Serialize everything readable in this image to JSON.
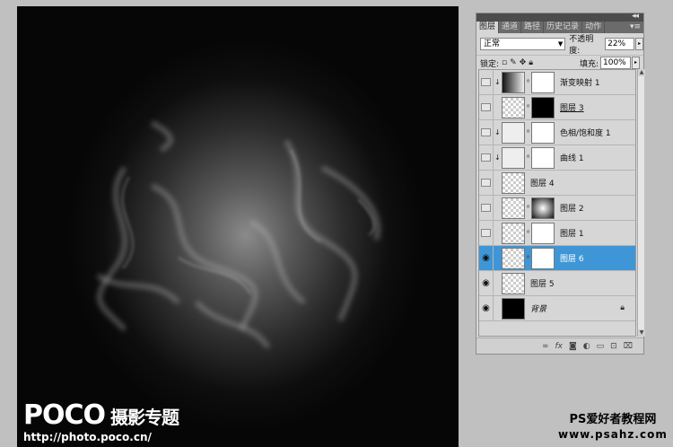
{
  "panel": {
    "collapse_glyph": "◂◂",
    "tabs": [
      {
        "label": "图层",
        "active": true
      },
      {
        "label": "通道",
        "active": false
      },
      {
        "label": "路径",
        "active": false
      },
      {
        "label": "历史记录",
        "active": false
      },
      {
        "label": "动作",
        "active": false
      }
    ],
    "menu_icon": "▾≡",
    "blend_mode": "正常",
    "opacity_label": "不透明度:",
    "opacity_value": "22%",
    "lock_label": "锁定:",
    "fill_label": "填充:",
    "fill_value": "100%"
  },
  "layers": [
    {
      "name": "渐变映射 1",
      "visible": false,
      "clipped": true,
      "thumb": "grad",
      "mask": "white",
      "selected": false
    },
    {
      "name": "图层 3",
      "visible": false,
      "clipped": false,
      "thumb": "checker",
      "mask": "black",
      "selected": false,
      "underline": true
    },
    {
      "name": "色相/饱和度 1",
      "visible": false,
      "clipped": true,
      "thumb": "adj",
      "mask": "white",
      "selected": false
    },
    {
      "name": "曲线 1",
      "visible": false,
      "clipped": true,
      "thumb": "adj",
      "mask": "white",
      "selected": false
    },
    {
      "name": "图层 4",
      "visible": false,
      "clipped": false,
      "thumb": "checker",
      "mask": null,
      "selected": false
    },
    {
      "name": "图层 2",
      "visible": false,
      "clipped": false,
      "thumb": "checker",
      "mask": "mask-rad",
      "selected": false
    },
    {
      "name": "图层 1",
      "visible": false,
      "clipped": false,
      "thumb": "checker",
      "mask": "white",
      "selected": false
    },
    {
      "name": "图层 6",
      "visible": true,
      "clipped": false,
      "thumb": "checker",
      "mask": "white",
      "selected": true
    },
    {
      "name": "图层 5",
      "visible": true,
      "clipped": false,
      "thumb": "checker",
      "mask": null,
      "selected": false
    },
    {
      "name": "背景",
      "visible": true,
      "clipped": false,
      "thumb": "black",
      "mask": null,
      "selected": false,
      "italic": true,
      "locked": true
    }
  ],
  "bottom_icons": [
    "link-icon",
    "fx-icon",
    "mask-icon",
    "adjustment-icon",
    "group-icon",
    "new-layer-icon",
    "trash-icon"
  ],
  "watermarks": {
    "left_logo": "POCO",
    "left_sub": "摄影专题",
    "left_url": "http://photo.poco.cn/",
    "right_title": "PS爱好者教程网",
    "right_url": "www.psahz.com"
  }
}
